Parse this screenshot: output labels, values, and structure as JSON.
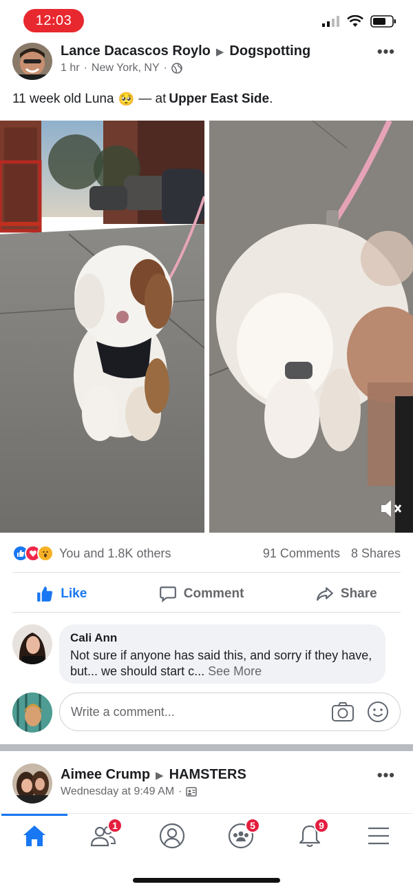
{
  "status_bar": {
    "time": "12:03"
  },
  "post1": {
    "author": "Lance Dacascos Roylo",
    "group": "Dogspotting",
    "time": "1 hr",
    "location": "New York, NY",
    "caption_prefix": "11 week old Luna",
    "caption_emoji": "🥺",
    "caption_mid": "— at",
    "place": "Upper East Side",
    "caption_end": ".",
    "reactions_text": "You and 1.8K others",
    "comments_count": "91 Comments",
    "shares_count": "8 Shares",
    "actions": {
      "like": "Like",
      "comment": "Comment",
      "share": "Share"
    },
    "top_comment": {
      "author": "Cali Ann",
      "text": "Not sure if anyone has said this, and sorry if they have, but... we should start c...",
      "see_more": "See More"
    },
    "write_comment_placeholder": "Write a comment..."
  },
  "post2": {
    "author": "Aimee Crump",
    "group": "HAMSTERS",
    "time": "Wednesday at 9:49 AM"
  },
  "bottom_nav": {
    "friends_badge": "1",
    "groups_badge": "5",
    "notifications_badge": "9"
  },
  "colors": {
    "accent": "#1877f2",
    "badge": "#e41e3f",
    "time_pill": "#e8282f"
  }
}
